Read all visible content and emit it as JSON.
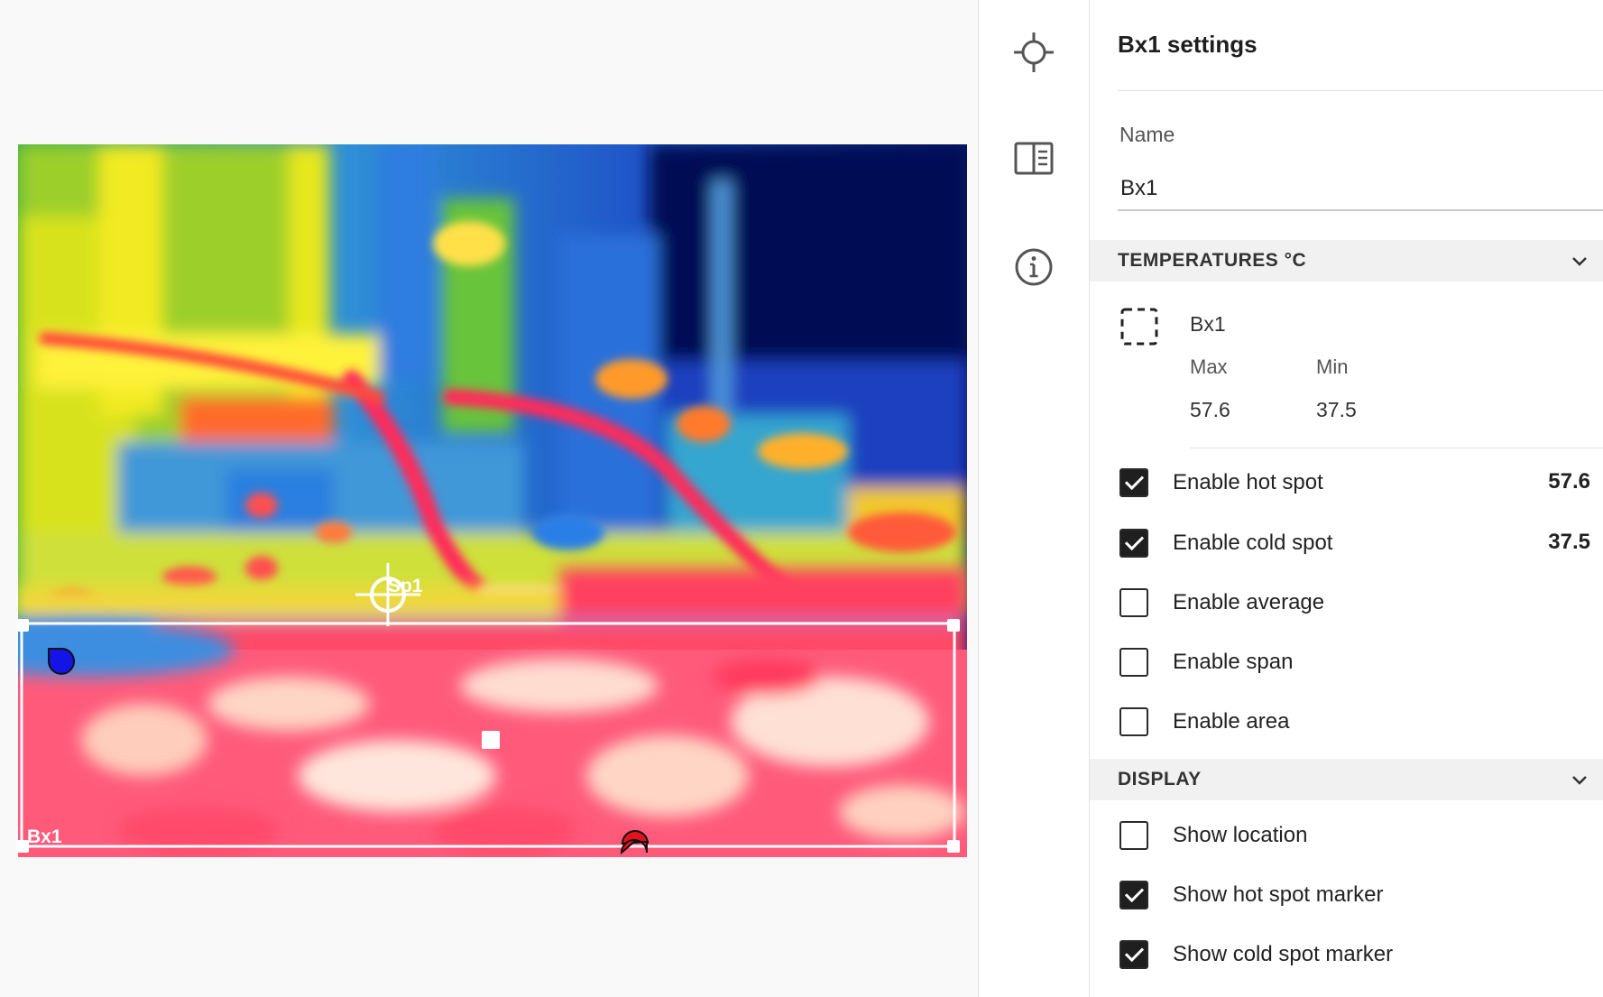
{
  "viewer": {
    "spot_label": "Sp1",
    "box_label": "Bx1"
  },
  "toolbar": {
    "tools": [
      {
        "icon": "crosshair-icon"
      },
      {
        "icon": "split-panel-icon"
      },
      {
        "icon": "info-icon"
      }
    ]
  },
  "settings": {
    "title": "Bx1 settings",
    "name_label": "Name",
    "name_value": "Bx1",
    "temperatures_header": "TEMPERATURES °C",
    "measurement": {
      "name": "Bx1",
      "max_label": "Max",
      "min_label": "Min",
      "max_value": "57.6",
      "min_value": "37.5"
    },
    "options": [
      {
        "label": "Enable hot spot",
        "checked": true,
        "value": "57.6"
      },
      {
        "label": "Enable cold spot",
        "checked": true,
        "value": "37.5"
      },
      {
        "label": "Enable average",
        "checked": false,
        "value": ""
      },
      {
        "label": "Enable span",
        "checked": false,
        "value": ""
      },
      {
        "label": "Enable area",
        "checked": false,
        "value": ""
      }
    ],
    "display_header": "DISPLAY",
    "display_options": [
      {
        "label": "Show location",
        "checked": false
      },
      {
        "label": "Show hot spot marker",
        "checked": true
      },
      {
        "label": "Show cold spot marker",
        "checked": true
      }
    ]
  },
  "colors": {
    "hot_marker": "#e0141e",
    "cold_marker": "#1414e6",
    "checkbox_checked": "#1f1f1f",
    "section_header_bg": "#f1f1f1"
  }
}
